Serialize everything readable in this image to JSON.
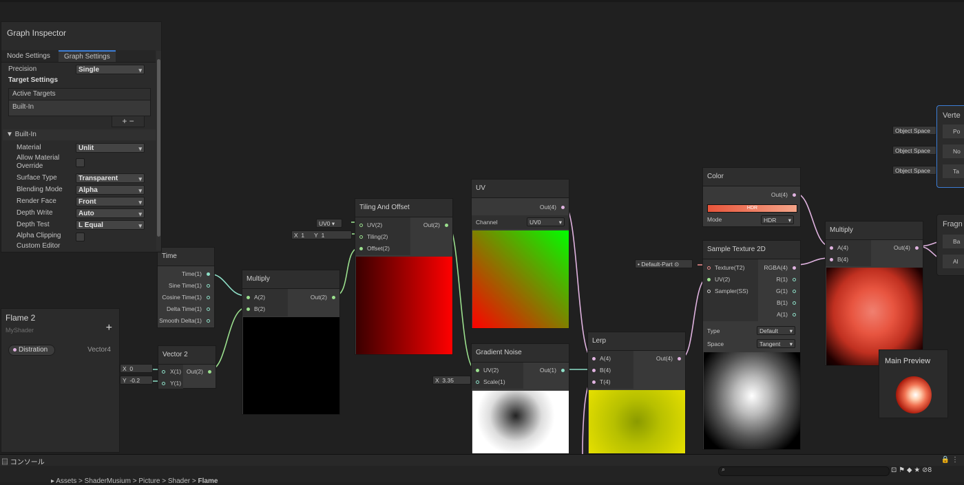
{
  "inspector": {
    "title": "Graph Inspector",
    "tabs": [
      "Node Settings",
      "Graph Settings"
    ],
    "precision": {
      "label": "Precision",
      "value": "Single"
    },
    "target_settings": "Target Settings",
    "active_targets": "Active Targets",
    "target_item": "Built-In",
    "add_remove": "+  −",
    "section": "▼  Built-In",
    "material": {
      "label": "Material",
      "value": "Unlit"
    },
    "allow_override_1": "Allow Material",
    "allow_override_2": "Override",
    "surface_type": {
      "label": "Surface Type",
      "value": "Transparent"
    },
    "blending_mode": {
      "label": "Blending Mode",
      "value": "Alpha"
    },
    "render_face": {
      "label": "Render Face",
      "value": "Front"
    },
    "depth_write": {
      "label": "Depth Write",
      "value": "Auto"
    },
    "depth_test": {
      "label": "Depth Test",
      "value": "L Equal"
    },
    "alpha_clipping": {
      "label": "Alpha Clipping"
    },
    "custom_editor": {
      "label": "Custom Editor"
    }
  },
  "blackboard": {
    "title": "Flame 2",
    "subtitle": "MyShader",
    "add": "+",
    "property_name": "Distration",
    "property_type": "Vector4"
  },
  "nodes": {
    "time": {
      "title": "Time",
      "outputs": [
        "Time(1)",
        "Sine Time(1)",
        "Cosine Time(1)",
        "Delta Time(1)",
        "Smooth Delta(1)"
      ]
    },
    "vector2": {
      "title": "Vector 2",
      "in_x": "X(1)",
      "in_y": "Y(1)",
      "out": "Out(2)",
      "x_label": "X",
      "x_val": "0",
      "y_label": "Y",
      "y_val": "-0.2"
    },
    "multiply1": {
      "title": "Multiply",
      "in_a": "A(2)",
      "in_b": "B(2)",
      "out": "Out(2)"
    },
    "tiling": {
      "title": "Tiling And Offset",
      "in_uv": "UV(2)",
      "in_tiling": "Tiling(2)",
      "in_offset": "Offset(2)",
      "out": "Out(2)",
      "uv_chip": "UV0",
      "x_label": "X",
      "x_val": "1",
      "y_label": "Y",
      "y_val": "1"
    },
    "uv": {
      "title": "UV",
      "out": "Out(4)",
      "channel_label": "Channel",
      "channel_value": "UV0"
    },
    "gradient": {
      "title": "Gradient Noise",
      "in_uv": "UV(2)",
      "in_scale": "Scale(1)",
      "out": "Out(1)",
      "scale_label": "X",
      "scale_val": "3.35"
    },
    "lerp": {
      "title": "Lerp",
      "in_a": "A(4)",
      "in_b": "B(4)",
      "in_t": "T(4)",
      "out": "Out(4)"
    },
    "color": {
      "title": "Color",
      "out": "Out(4)",
      "hdr": "HDR",
      "mode_label": "Mode",
      "mode_value": "HDR"
    },
    "sample": {
      "title": "Sample Texture 2D",
      "in_tex": "Texture(T2)",
      "in_uv": "UV(2)",
      "in_sampler": "Sampler(SS)",
      "outs": [
        "RGBA(4)",
        "R(1)",
        "G(1)",
        "B(1)",
        "A(1)"
      ],
      "type_label": "Type",
      "type_value": "Default",
      "space_label": "Space",
      "space_value": "Tangent",
      "tex_chip": "Default-Part"
    },
    "multiply2": {
      "title": "Multiply",
      "in_a": "A(4)",
      "in_b": "B(4)",
      "out": "Out(4)"
    },
    "vertex": {
      "title": "Verte",
      "chips": [
        "Object Space",
        "Object Space",
        "Object Space"
      ],
      "ports": [
        "Po",
        "No",
        "Ta"
      ]
    },
    "fragment": {
      "title": "Fragn",
      "ports": [
        "Ba",
        "Al"
      ]
    }
  },
  "main_preview": {
    "title": "Main Preview"
  },
  "console": {
    "tab": "コンソール",
    "breadcrumb": [
      "Assets",
      "ShaderMusium",
      "Picture",
      "Shader",
      "Flame"
    ],
    "count": "8"
  },
  "colors": {
    "accent": "#3d7ed6",
    "wire_float": "#8ee0c8",
    "wire_vec2": "#9be08e",
    "wire_vec4": "#e0b3e0",
    "wire_tex": "#e88a8a"
  }
}
